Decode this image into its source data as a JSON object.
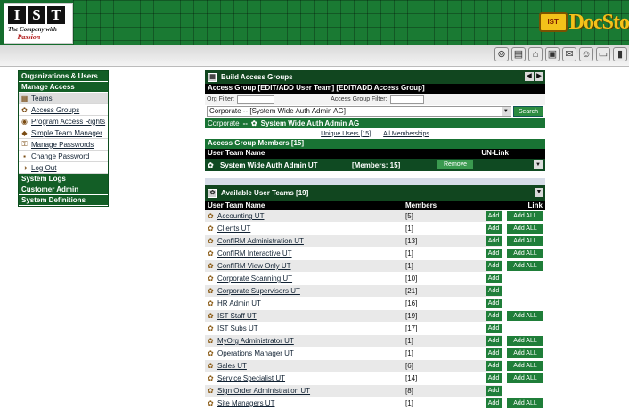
{
  "header": {
    "logo_letters": [
      "I",
      "S",
      "T"
    ],
    "logo_tagline_1": "The Company with",
    "logo_tagline_2": "Passion",
    "brand_badge": "IST",
    "brand_word": "DocSto"
  },
  "toolbar": {
    "icons": [
      "binoculars-icon",
      "printer-icon",
      "scanner-icon",
      "fax-icon",
      "envelope-icon",
      "users-icon",
      "document-icon",
      "folder-icon"
    ]
  },
  "nav": {
    "sections": [
      {
        "header": "Organizations & Users"
      },
      {
        "header": "Manage Access",
        "items": [
          {
            "label": "Teams",
            "icon": "team-icon",
            "selected": true
          },
          {
            "label": "Access Groups",
            "icon": "group-icon"
          },
          {
            "label": "Program Access Rights",
            "icon": "rights-icon"
          },
          {
            "label": "Simple Team Manager",
            "icon": "manager-icon"
          },
          {
            "label": "Manage Passwords",
            "icon": "key-icon"
          },
          {
            "label": "Change Password",
            "icon": "lock-icon"
          },
          {
            "label": "Log Out",
            "icon": "logout-icon"
          }
        ]
      },
      {
        "header": "System Logs"
      },
      {
        "header": "Customer Admin"
      },
      {
        "header": "System Definitions"
      }
    ]
  },
  "build_panel": {
    "title": "Build Access Groups",
    "context_bar": "Access Group [EDIT/ADD User Team] [EDIT/ADD Access Group]",
    "org_filter_label": "Org Filter:",
    "access_group_filter_label": "Access Group Filter:",
    "selected_group": "Corporate -- [System Wide Auth Admin AG]",
    "search_label": "Search",
    "org_bar_org": "Corporate",
    "org_bar_sep": "--",
    "org_bar_group": "System Wide Auth Admin AG",
    "unique_users": "Unique Users [15]",
    "all_memberships": "All Memberships",
    "members_header": "Access Group Members [15]",
    "members_col_name": "User Team Name",
    "members_col_unlink": "UN-Link",
    "member_name": "System Wide Auth Admin UT",
    "member_count": "[Members: 15]",
    "remove_label": "Remove"
  },
  "teams_panel": {
    "title": "Available User Teams [19]",
    "col_name": "User Team Name",
    "col_members": "Members",
    "col_link": "Link",
    "add_label": "Add",
    "add_all_label": "Add ALL",
    "rows": [
      {
        "name": "Accounting UT",
        "members": "[5]",
        "add_all": "Add ALL"
      },
      {
        "name": "Clients UT",
        "members": "[1]",
        "add_all": "Add ALL"
      },
      {
        "name": "ConfIRM Administration UT",
        "members": "[13]",
        "add_all": "Add ALL"
      },
      {
        "name": "ConfIRM Interactive UT",
        "members": "[1]",
        "add_all": "Add ALL"
      },
      {
        "name": "ConfIRM View Only UT",
        "members": "[1]",
        "add_all": "Add ALL"
      },
      {
        "name": "Corporate Scanning UT",
        "members": "[10]",
        "add_all": ""
      },
      {
        "name": "Corporate Supervisors UT",
        "members": "[21]",
        "add_all": ""
      },
      {
        "name": "HR Admin UT",
        "members": "[16]",
        "add_all": ""
      },
      {
        "name": "IST Staff UT",
        "members": "[19]",
        "add_all": "Add ALL"
      },
      {
        "name": "IST Subs UT",
        "members": "[17]",
        "add_all": ""
      },
      {
        "name": "MyOrg Administrator UT",
        "members": "[1]",
        "add_all": "Add ALL"
      },
      {
        "name": "Operations Manager UT",
        "members": "[1]",
        "add_all": "Add ALL"
      },
      {
        "name": "Sales UT",
        "members": "[6]",
        "add_all": "Add ALL"
      },
      {
        "name": "Service Specialist UT",
        "members": "[14]",
        "add_all": "Add ALL"
      },
      {
        "name": "Sign Order Administration UT",
        "members": "[8]",
        "add_all": ""
      },
      {
        "name": "Site Managers UT",
        "members": "[1]",
        "add_all": "Add ALL"
      }
    ]
  }
}
